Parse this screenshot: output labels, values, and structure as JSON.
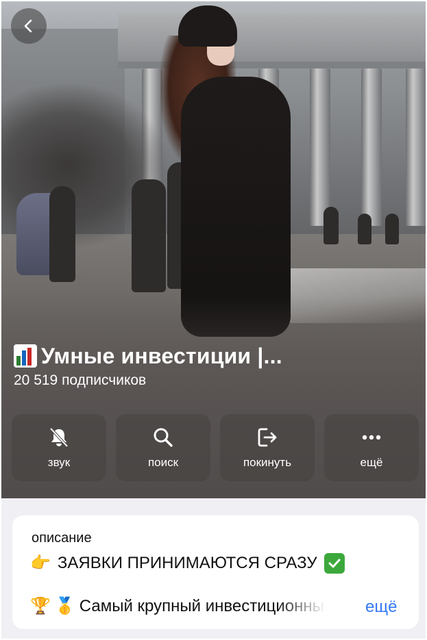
{
  "header": {
    "back_icon": "chevron-left-icon"
  },
  "channel": {
    "title_icon": "bar-chart-icon",
    "title": "Умные инвестиции |...",
    "subscribers": "20 519 подписчиков"
  },
  "actions": [
    {
      "label": "звук",
      "icon": "bell-slash-icon"
    },
    {
      "label": "поиск",
      "icon": "search-icon"
    },
    {
      "label": "покинуть",
      "icon": "leave-icon"
    },
    {
      "label": "ещё",
      "icon": "more-dots-icon"
    }
  ],
  "description": {
    "label": "описание",
    "line1_emoji": "👉",
    "line1_text": "ЗАЯВКИ ПРИНИМАЮТСЯ СРАЗУ",
    "line1_check_icon": "check-mark-icon",
    "line2_emoji_1": "🏆",
    "line2_emoji_2": "🥇",
    "line2_text": "Самый крупный инвестиционный",
    "more_label": "ещё"
  },
  "colors": {
    "link": "#3478f6",
    "card_bg": "#ffffff",
    "page_bg": "#efeff4"
  }
}
